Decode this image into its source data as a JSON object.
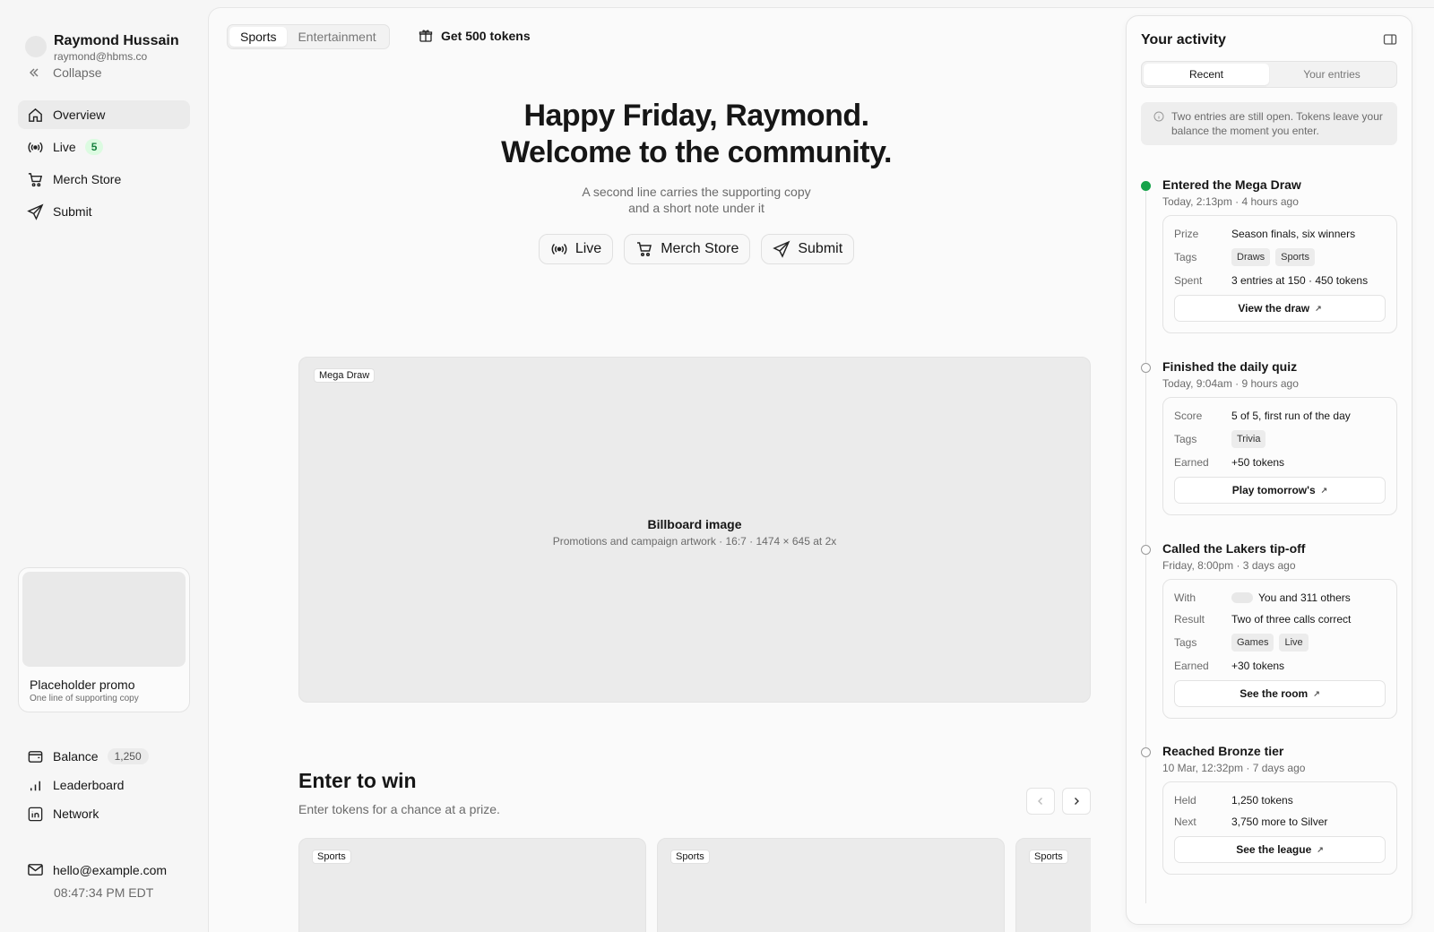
{
  "user": {
    "name": "Raymond Hussain",
    "email": "raymond@hbms.co"
  },
  "sidebar": {
    "collapse_label": "Collapse",
    "items": [
      {
        "label": "Overview",
        "icon": "home-icon",
        "active": true
      },
      {
        "label": "Live",
        "icon": "broadcast-icon",
        "badge": "5"
      },
      {
        "label": "Merch Store",
        "icon": "cart-icon"
      },
      {
        "label": "Submit",
        "icon": "send-icon"
      }
    ],
    "promo": {
      "title": "Placeholder promo",
      "subtitle": "One line of supporting copy"
    },
    "bottom": [
      {
        "label": "Balance",
        "icon": "wallet-icon",
        "badge": "1,250"
      },
      {
        "label": "Leaderboard",
        "icon": "bar-chart-icon"
      },
      {
        "label": "Network",
        "icon": "linkedin-icon"
      }
    ],
    "contact": {
      "email": "hello@example.com",
      "clock": "08:47:34 PM EDT"
    }
  },
  "header": {
    "tabs": [
      {
        "label": "Sports",
        "active": true
      },
      {
        "label": "Entertainment"
      }
    ],
    "tokens_link": "Get 500 tokens"
  },
  "hero": {
    "line1": "Happy Friday, Raymond.",
    "line2": "Welcome to the community.",
    "sub1": "A second line carries the supporting copy",
    "sub2": "and a short note under it",
    "buttons": [
      {
        "label": "Live"
      },
      {
        "label": "Merch Store"
      },
      {
        "label": "Submit"
      }
    ]
  },
  "billboard": {
    "tag": "Mega Draw",
    "title": "Billboard image",
    "subtitle": "Promotions and campaign artwork · 16:7 · 1474 × 645 at 2x"
  },
  "enter_to_win": {
    "title": "Enter to win",
    "subtitle": "Enter tokens for a chance at a prize.",
    "cards": [
      {
        "tag": "Sports"
      },
      {
        "tag": "Sports"
      },
      {
        "tag": "Sports"
      }
    ]
  },
  "activity": {
    "title": "Your activity",
    "tabs": [
      {
        "label": "Recent",
        "active": true
      },
      {
        "label": "Your entries"
      }
    ],
    "notice": "Two entries are still open. Tokens leave your balance the moment you enter.",
    "events": [
      {
        "title": "Entered the Mega Draw",
        "time": "Today, 2:13pm · 4 hours ago",
        "rows": {
          "prize_k": "Prize",
          "prize_v": "Season finals, six winners",
          "tags_k": "Tags",
          "tag1": "Draws",
          "tag2": "Sports",
          "spent_k": "Spent",
          "spent_v": "3 entries at 150 · 450 tokens"
        },
        "button": "View the draw"
      },
      {
        "title": "Finished the daily quiz",
        "time": "Today, 9:04am · 9 hours ago",
        "rows": {
          "score_k": "Score",
          "score_v": "5 of 5, first run of the day",
          "tags_k": "Tags",
          "tag1": "Trivia",
          "earned_k": "Earned",
          "earned_v": "+50 tokens"
        },
        "button": "Play tomorrow's"
      },
      {
        "title": "Called the Lakers tip-off",
        "time": "Friday, 8:00pm · 3 days ago",
        "rows": {
          "with_k": "With",
          "with_v": "You and 311 others",
          "result_k": "Result",
          "result_v": "Two of three calls correct",
          "tags_k": "Tags",
          "tag1": "Games",
          "tag2": "Live",
          "earned_k": "Earned",
          "earned_v": "+30 tokens"
        },
        "button": "See the room"
      },
      {
        "title": "Reached Bronze tier",
        "time": "10 Mar, 12:32pm · 7 days ago",
        "rows": {
          "held_k": "Held",
          "held_v": "1,250 tokens",
          "next_k": "Next",
          "next_v": "3,750 more to Silver"
        },
        "button": "See the league"
      }
    ]
  },
  "colors": {
    "accent_green": "#16a34a",
    "badge_green_bg": "#dcfbe1"
  }
}
